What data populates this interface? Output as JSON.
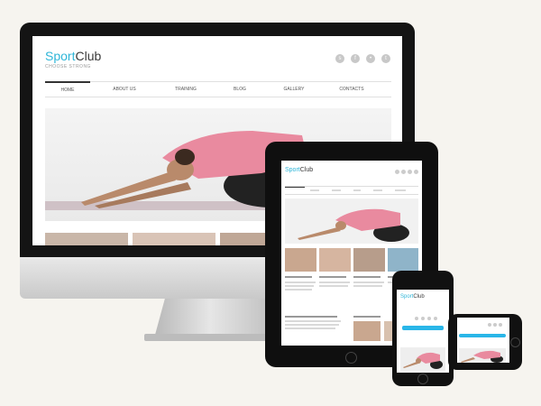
{
  "site": {
    "logo_part1": "Sport",
    "logo_part2": "Club",
    "tagline": "CHOOSE STRONG"
  },
  "nav": {
    "items": [
      {
        "label": "HOME",
        "active": true
      },
      {
        "label": "ABOUT US"
      },
      {
        "label": "TRAINING"
      },
      {
        "label": "BLOG"
      },
      {
        "label": "GALLERY"
      },
      {
        "label": "CONTACTS"
      }
    ]
  },
  "social_icons": [
    "skype-icon",
    "facebook-icon",
    "flickr-icon",
    "tumblr-icon"
  ],
  "social_glyphs": [
    "s",
    "f",
    "•",
    "t"
  ],
  "colors": {
    "accent": "#2fb6d8",
    "device_bezel": "#141414",
    "page_background": "#f6f4ef",
    "shirt": "#e98a9f"
  }
}
